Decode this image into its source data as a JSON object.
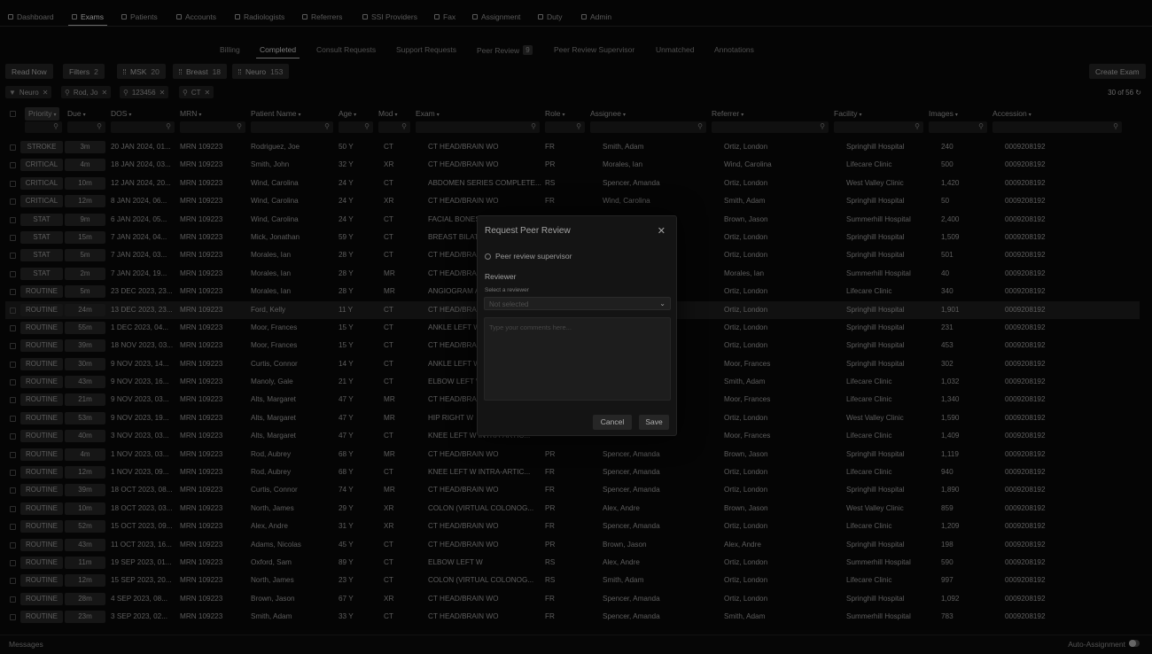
{
  "nav": {
    "items": [
      {
        "label": "Dashboard",
        "icon": "grid-icon"
      },
      {
        "label": "Exams",
        "icon": "exams-icon",
        "active": true
      },
      {
        "label": "Patients",
        "icon": "patients-icon"
      },
      {
        "label": "Accounts",
        "icon": "accounts-icon"
      },
      {
        "label": "Radiologists",
        "icon": "radiologists-icon"
      },
      {
        "label": "Referrers",
        "icon": "referrers-icon"
      },
      {
        "label": "SSI Providers",
        "icon": "providers-icon"
      },
      {
        "label": "Fax",
        "icon": "fax-icon"
      },
      {
        "label": "Assignment",
        "icon": "assignment-icon"
      },
      {
        "label": "Duty",
        "icon": "duty-icon"
      },
      {
        "label": "Admin",
        "icon": "admin-icon"
      }
    ]
  },
  "subtabs": [
    {
      "label": "Billing"
    },
    {
      "label": "Completed",
      "active": true
    },
    {
      "label": "Consult Requests"
    },
    {
      "label": "Support Requests"
    },
    {
      "label": "Peer Review",
      "badge": "9"
    },
    {
      "label": "Peer Review Supervisor"
    },
    {
      "label": "Unmatched"
    },
    {
      "label": "Annotations"
    }
  ],
  "toolbar": {
    "read_now": "Read Now",
    "filters": "Filters",
    "filters_count": "2",
    "msk": "MSK",
    "msk_count": "20",
    "breast": "Breast",
    "breast_count": "18",
    "neuro": "Neuro",
    "neuro_count": "153",
    "create_exam": "Create Exam"
  },
  "chips": [
    "Neuro",
    "Rod, Jo",
    "123456",
    "CT"
  ],
  "count_label": "30 of 56",
  "columns": [
    "Priority",
    "Due",
    "DOS",
    "MRN",
    "Patient Name",
    "Age",
    "Mod",
    "Exam",
    "Role",
    "Assignee",
    "Referrer",
    "Facility",
    "Images",
    "Accession"
  ],
  "rows": [
    {
      "priority": "STROKE",
      "due": "3m",
      "dos": "20 JAN 2024, 01...",
      "mrn": "MRN 109223",
      "patient": "Rodriguez, Joe",
      "age": "50 Y",
      "mod": "CT",
      "exam": "CT HEAD/BRAIN WO",
      "role": "FR",
      "assignee": "Smith, Adam",
      "referrer": "Ortiz, London",
      "facility": "Springhill Hospital",
      "images": "240",
      "accession": "0009208192"
    },
    {
      "priority": "CRITICAL",
      "due": "4m",
      "dos": "18 JAN 2024, 03...",
      "mrn": "MRN 109223",
      "patient": "Smith, John",
      "age": "32 Y",
      "mod": "XR",
      "exam": "CT HEAD/BRAIN WO",
      "role": "PR",
      "assignee": "Morales, Ian",
      "referrer": "Wind, Carolina",
      "facility": "Lifecare Clinic",
      "images": "500",
      "accession": "0009208192"
    },
    {
      "priority": "CRITICAL",
      "due": "10m",
      "dos": "12 JAN 2024, 20...",
      "mrn": "MRN 109223",
      "patient": "Wind, Carolina",
      "age": "24 Y",
      "mod": "CT",
      "exam": "ABDOMEN SERIES COMPLETE...",
      "role": "RS",
      "assignee": "Spencer, Amanda",
      "referrer": "Ortiz, London",
      "facility": "West Valley Clinic",
      "images": "1,420",
      "accession": "0009208192"
    },
    {
      "priority": "CRITICAL",
      "due": "12m",
      "dos": "8 JAN 2024, 06...",
      "mrn": "MRN 109223",
      "patient": "Wind, Carolina",
      "age": "24 Y",
      "mod": "XR",
      "exam": "CT HEAD/BRAIN WO",
      "role": "FR",
      "assignee": "Wind, Carolina",
      "referrer": "Smith, Adam",
      "facility": "Springhill Hospital",
      "images": "50",
      "accession": "0009208192"
    },
    {
      "priority": "STAT",
      "due": "9m",
      "dos": "6 JAN 2024, 05...",
      "mrn": "MRN 109223",
      "patient": "Wind, Carolina",
      "age": "24 Y",
      "mod": "CT",
      "exam": "FACIAL BONES",
      "role": "",
      "assignee": "",
      "referrer": "Brown, Jason",
      "facility": "Summerhill Hospital",
      "images": "2,400",
      "accession": "0009208192"
    },
    {
      "priority": "STAT",
      "due": "15m",
      "dos": "7 JAN 2024, 04...",
      "mrn": "MRN 109223",
      "patient": "Mick, Jonathan",
      "age": "59 Y",
      "mod": "CT",
      "exam": "BREAST BILAT",
      "role": "",
      "assignee": "",
      "referrer": "Ortiz, London",
      "facility": "Springhill Hospital",
      "images": "1,509",
      "accession": "0009208192"
    },
    {
      "priority": "STAT",
      "due": "5m",
      "dos": "7 JAN 2024, 03...",
      "mrn": "MRN 109223",
      "patient": "Morales, Ian",
      "age": "28 Y",
      "mod": "CT",
      "exam": "CT HEAD/BRA",
      "role": "",
      "assignee": "",
      "referrer": "Ortiz, London",
      "facility": "Springhill Hospital",
      "images": "501",
      "accession": "0009208192"
    },
    {
      "priority": "STAT",
      "due": "2m",
      "dos": "7 JAN 2024, 19...",
      "mrn": "MRN 109223",
      "patient": "Morales, Ian",
      "age": "28 Y",
      "mod": "MR",
      "exam": "CT HEAD/BRA",
      "role": "",
      "assignee": "",
      "referrer": "Morales, Ian",
      "facility": "Summerhill Hospital",
      "images": "40",
      "accession": "0009208192"
    },
    {
      "priority": "ROUTINE",
      "due": "5m",
      "dos": "23 DEC 2023, 23...",
      "mrn": "MRN 109223",
      "patient": "Morales, Ian",
      "age": "28 Y",
      "mod": "MR",
      "exam": "ANGIOGRAM A",
      "role": "",
      "assignee": "",
      "referrer": "Ortiz, London",
      "facility": "Lifecare Clinic",
      "images": "340",
      "accession": "0009208192"
    },
    {
      "priority": "ROUTINE",
      "due": "24m",
      "dos": "13 DEC 2023, 23...",
      "mrn": "MRN 109223",
      "patient": "Ford, Kelly",
      "age": "11 Y",
      "mod": "CT",
      "exam": "CT HEAD/BRA",
      "role": "",
      "assignee": "",
      "referrer": "Ortiz, London",
      "facility": "Springhill Hospital",
      "images": "1,901",
      "accession": "0009208192",
      "hl": true
    },
    {
      "priority": "ROUTINE",
      "due": "55m",
      "dos": "1 DEC 2023, 04...",
      "mrn": "MRN 109223",
      "patient": "Moor, Frances",
      "age": "15 Y",
      "mod": "CT",
      "exam": "ANKLE LEFT W",
      "role": "",
      "assignee": "",
      "referrer": "Ortiz, London",
      "facility": "Springhill Hospital",
      "images": "231",
      "accession": "0009208192"
    },
    {
      "priority": "ROUTINE",
      "due": "39m",
      "dos": "18 NOV 2023, 03...",
      "mrn": "MRN 109223",
      "patient": "Moor, Frances",
      "age": "15 Y",
      "mod": "CT",
      "exam": "CT HEAD/BRA",
      "role": "",
      "assignee": "",
      "referrer": "Ortiz, London",
      "facility": "Springhill Hospital",
      "images": "453",
      "accession": "0009208192"
    },
    {
      "priority": "ROUTINE",
      "due": "30m",
      "dos": "9 NOV 2023, 14...",
      "mrn": "MRN 109223",
      "patient": "Curtis, Connor",
      "age": "14 Y",
      "mod": "CT",
      "exam": "ANKLE LEFT W",
      "role": "",
      "assignee": "",
      "referrer": "Moor, Frances",
      "facility": "Springhill Hospital",
      "images": "302",
      "accession": "0009208192"
    },
    {
      "priority": "ROUTINE",
      "due": "43m",
      "dos": "9 NOV 2023, 16...",
      "mrn": "MRN 109223",
      "patient": "Manoly, Gale",
      "age": "21 Y",
      "mod": "CT",
      "exam": "ELBOW LEFT W",
      "role": "",
      "assignee": "",
      "referrer": "Smith, Adam",
      "facility": "Lifecare Clinic",
      "images": "1,032",
      "accession": "0009208192"
    },
    {
      "priority": "ROUTINE",
      "due": "21m",
      "dos": "9 NOV 2023, 03...",
      "mrn": "MRN 109223",
      "patient": "Alts, Margaret",
      "age": "47 Y",
      "mod": "MR",
      "exam": "CT HEAD/BRA",
      "role": "",
      "assignee": "",
      "referrer": "Moor, Frances",
      "facility": "Lifecare Clinic",
      "images": "1,340",
      "accession": "0009208192"
    },
    {
      "priority": "ROUTINE",
      "due": "53m",
      "dos": "9 NOV 2023, 19...",
      "mrn": "MRN 109223",
      "patient": "Alts, Margaret",
      "age": "47 Y",
      "mod": "MR",
      "exam": "HIP RIGHT W",
      "role": "",
      "assignee": "",
      "referrer": "Ortiz, London",
      "facility": "West Valley Clinic",
      "images": "1,590",
      "accession": "0009208192"
    },
    {
      "priority": "ROUTINE",
      "due": "40m",
      "dos": "3 NOV 2023, 03...",
      "mrn": "MRN 109223",
      "patient": "Alts, Margaret",
      "age": "47 Y",
      "mod": "CT",
      "exam": "KNEE LEFT W INTRA-ARTIC...",
      "role": "",
      "assignee": "",
      "referrer": "Moor, Frances",
      "facility": "Lifecare Clinic",
      "images": "1,409",
      "accession": "0009208192"
    },
    {
      "priority": "ROUTINE",
      "due": "4m",
      "dos": "1 NOV 2023, 03...",
      "mrn": "MRN 109223",
      "patient": "Rod, Aubrey",
      "age": "68 Y",
      "mod": "MR",
      "exam": "CT HEAD/BRAIN WO",
      "role": "PR",
      "assignee": "Spencer, Amanda",
      "referrer": "Brown, Jason",
      "facility": "Springhill Hospital",
      "images": "1,119",
      "accession": "0009208192"
    },
    {
      "priority": "ROUTINE",
      "due": "12m",
      "dos": "1 NOV 2023, 09...",
      "mrn": "MRN 109223",
      "patient": "Rod, Aubrey",
      "age": "68 Y",
      "mod": "CT",
      "exam": "KNEE LEFT W INTRA-ARTIC...",
      "role": "FR",
      "assignee": "Spencer, Amanda",
      "referrer": "Ortiz, London",
      "facility": "Lifecare Clinic",
      "images": "940",
      "accession": "0009208192"
    },
    {
      "priority": "ROUTINE",
      "due": "39m",
      "dos": "18 OCT 2023, 08...",
      "mrn": "MRN 109223",
      "patient": "Curtis, Connor",
      "age": "74 Y",
      "mod": "MR",
      "exam": "CT HEAD/BRAIN WO",
      "role": "FR",
      "assignee": "Spencer, Amanda",
      "referrer": "Ortiz, London",
      "facility": "Springhill Hospital",
      "images": "1,890",
      "accession": "0009208192"
    },
    {
      "priority": "ROUTINE",
      "due": "10m",
      "dos": "18 OCT 2023, 03...",
      "mrn": "MRN 109223",
      "patient": "North, James",
      "age": "29 Y",
      "mod": "XR",
      "exam": "COLON (VIRTUAL COLONOG...",
      "role": "PR",
      "assignee": "Alex, Andre",
      "referrer": "Brown, Jason",
      "facility": "West Valley Clinic",
      "images": "859",
      "accession": "0009208192"
    },
    {
      "priority": "ROUTINE",
      "due": "52m",
      "dos": "15 OCT 2023, 09...",
      "mrn": "MRN 109223",
      "patient": "Alex, Andre",
      "age": "31 Y",
      "mod": "XR",
      "exam": "CT HEAD/BRAIN WO",
      "role": "FR",
      "assignee": "Spencer, Amanda",
      "referrer": "Ortiz, London",
      "facility": "Lifecare Clinic",
      "images": "1,209",
      "accession": "0009208192"
    },
    {
      "priority": "ROUTINE",
      "due": "43m",
      "dos": "11 OCT 2023, 16...",
      "mrn": "MRN 109223",
      "patient": "Adams, Nicolas",
      "age": "45 Y",
      "mod": "CT",
      "exam": "CT HEAD/BRAIN WO",
      "role": "PR",
      "assignee": "Brown, Jason",
      "referrer": "Alex, Andre",
      "facility": "Springhill Hospital",
      "images": "198",
      "accession": "0009208192"
    },
    {
      "priority": "ROUTINE",
      "due": "11m",
      "dos": "19 SEP 2023, 01...",
      "mrn": "MRN 109223",
      "patient": "Oxford, Sam",
      "age": "89 Y",
      "mod": "CT",
      "exam": "ELBOW LEFT W",
      "role": "RS",
      "assignee": "Alex, Andre",
      "referrer": "Ortiz, London",
      "facility": "Summerhill Hospital",
      "images": "590",
      "accession": "0009208192"
    },
    {
      "priority": "ROUTINE",
      "due": "12m",
      "dos": "15 SEP 2023, 20...",
      "mrn": "MRN 109223",
      "patient": "North, James",
      "age": "23 Y",
      "mod": "CT",
      "exam": "COLON (VIRTUAL COLONOG...",
      "role": "RS",
      "assignee": "Smith, Adam",
      "referrer": "Ortiz, London",
      "facility": "Lifecare Clinic",
      "images": "997",
      "accession": "0009208192"
    },
    {
      "priority": "ROUTINE",
      "due": "28m",
      "dos": "4 SEP 2023, 08...",
      "mrn": "MRN 109223",
      "patient": "Brown, Jason",
      "age": "67 Y",
      "mod": "XR",
      "exam": "CT HEAD/BRAIN WO",
      "role": "FR",
      "assignee": "Spencer, Amanda",
      "referrer": "Ortiz, London",
      "facility": "Springhill Hospital",
      "images": "1,092",
      "accession": "0009208192"
    },
    {
      "priority": "ROUTINE",
      "due": "23m",
      "dos": "3 SEP 2023, 02...",
      "mrn": "MRN 109223",
      "patient": "Smith, Adam",
      "age": "33 Y",
      "mod": "CT",
      "exam": "CT HEAD/BRAIN WO",
      "role": "FR",
      "assignee": "Spencer, Amanda",
      "referrer": "Smith, Adam",
      "facility": "Summerhill Hospital",
      "images": "783",
      "accession": "0009208192"
    }
  ],
  "footer": {
    "messages": "Messages",
    "auto_assignment": "Auto-Assignment"
  },
  "modal": {
    "title": "Request Peer Review",
    "radio_label": "Peer review supervisor",
    "reviewer_heading": "Reviewer",
    "select_label": "Select a reviewer",
    "select_placeholder": "Not selected",
    "comment_placeholder": "Type your comments here...",
    "cancel": "Cancel",
    "save": "Save"
  }
}
